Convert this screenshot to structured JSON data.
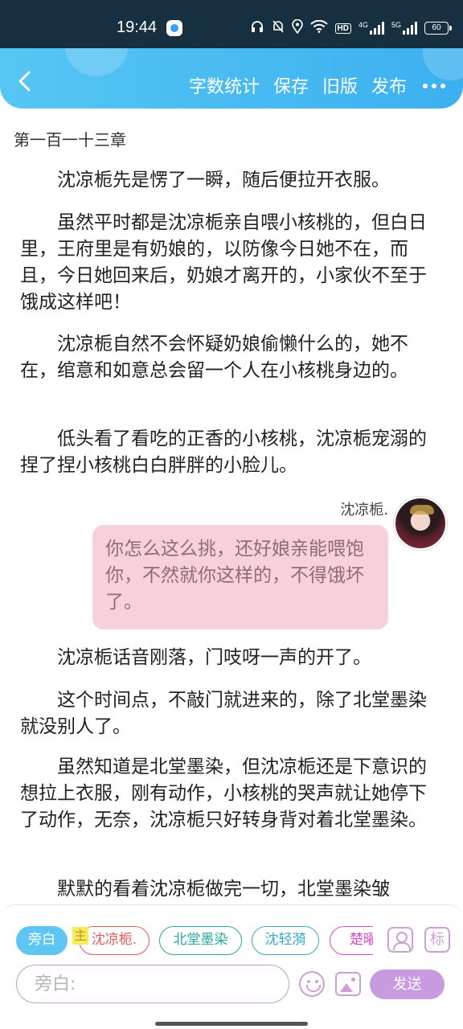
{
  "status_bar": {
    "time": "19:44",
    "hd_label": "HD",
    "signal1_label": "4G",
    "signal2_label": "5G",
    "battery": "60"
  },
  "toolbar": {
    "word_count_label": "字数统计",
    "save_label": "保存",
    "old_version_label": "旧版",
    "publish_label": "发布"
  },
  "content": {
    "chapter_title": "第一百一十三章",
    "paragraphs": [
      "沈凉栀先是愣了一瞬，随后便拉开衣服。",
      "虽然平时都是沈凉栀亲自喂小核桃的，但白日里，王府里是有奶娘的，以防像今日她不在，而且，今日她回来后，奶娘才离开的，小家伙不至于饿成这样吧！",
      "沈凉栀自然不会怀疑奶娘偷懒什么的，她不在，绾意和如意总会留一个人在小核桃身边的。",
      "低头看了看吃的正香的小核桃，沈凉栀宠溺的捏了捏小核桃白白胖胖的小脸儿。"
    ],
    "dialog": {
      "speaker": "沈凉栀.",
      "text": "你怎么这么挑，还好娘亲能喂饱你，不然就你这样的，不得饿坏了。"
    },
    "paragraphs_after": [
      "沈凉栀话音刚落，门吱呀一声的开了。",
      "这个时间点，不敲门就进来的，除了北堂墨染就没别人了。",
      "虽然知道是北堂墨染，但沈凉栀还是下意识的想拉上衣服，刚有动作，小核桃的哭声就让她停下了动作，无奈，沈凉栀只好转身背对着北堂墨染。",
      "默默的看着沈凉栀做完一切，北堂墨染皱"
    ]
  },
  "editor": {
    "roles": [
      "旁白",
      "沈凉栀.",
      "北堂墨染",
      "沈轻漪",
      "楚曜"
    ],
    "main_tag": "主",
    "tag_button_label": "标",
    "input_placeholder": "旁白:",
    "send_label": "发送"
  }
}
